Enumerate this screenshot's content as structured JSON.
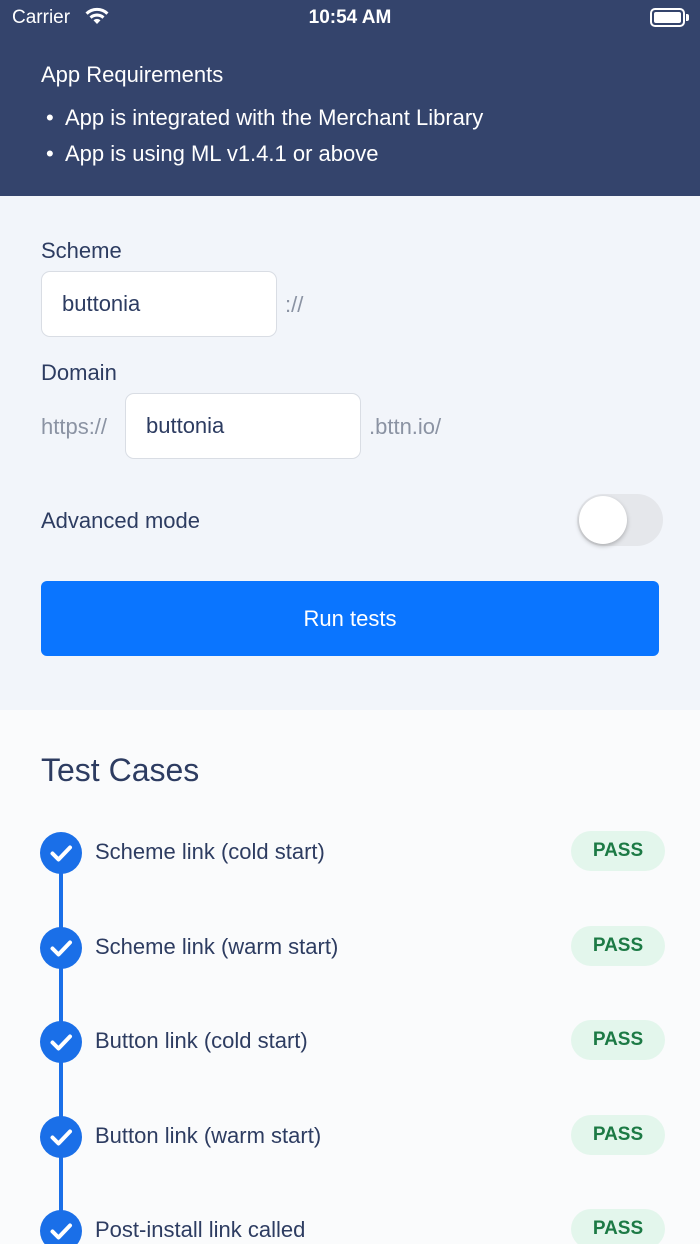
{
  "status_bar": {
    "carrier": "Carrier",
    "time": "10:54 AM"
  },
  "requirements": {
    "title": "App Requirements",
    "bullet": "•",
    "items": [
      "App is integrated with the Merchant Library",
      "App is using ML v1.4.1 or above"
    ]
  },
  "form": {
    "scheme_label": "Scheme",
    "scheme_value": "buttonia",
    "scheme_suffix": "://",
    "domain_label": "Domain",
    "domain_prefix": "https://",
    "domain_value": "buttonia",
    "domain_suffix": ".bttn.io/",
    "advanced_label": "Advanced mode",
    "advanced_enabled": false,
    "run_button": "Run tests"
  },
  "test_cases": {
    "title": "Test Cases",
    "items": [
      {
        "name": "Scheme link (cold start)",
        "status": "PASS"
      },
      {
        "name": "Scheme link (warm start)",
        "status": "PASS"
      },
      {
        "name": "Button link (cold start)",
        "status": "PASS"
      },
      {
        "name": "Button link (warm start)",
        "status": "PASS"
      },
      {
        "name": "Post-install link called",
        "status": "PASS"
      }
    ]
  },
  "colors": {
    "header_bg": "#34446c",
    "accent": "#0a75ff",
    "pass_bg": "#e3f6ec",
    "pass_text": "#1c7a45"
  }
}
